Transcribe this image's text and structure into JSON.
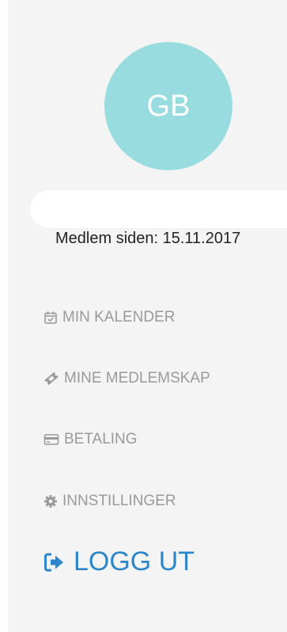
{
  "profile": {
    "initials": "GB",
    "member_since": "Medlem siden: 15.11.2017"
  },
  "nav": {
    "items": [
      {
        "label": "MIN KALENDER",
        "icon": "calendar-check-icon"
      },
      {
        "label": "MINE MEDLEMSKAP",
        "icon": "ticket-icon"
      },
      {
        "label": "BETALING",
        "icon": "credit-card-icon"
      },
      {
        "label": "INNSTILLINGER",
        "icon": "gear-icon"
      }
    ],
    "logout": {
      "label": "LOGG UT",
      "icon": "sign-out-icon"
    }
  },
  "colors": {
    "avatar": "#99dcdf",
    "panel_background": "#f4f4f4",
    "nav_text": "#9a9a9a",
    "logout": "#2f86c6"
  }
}
